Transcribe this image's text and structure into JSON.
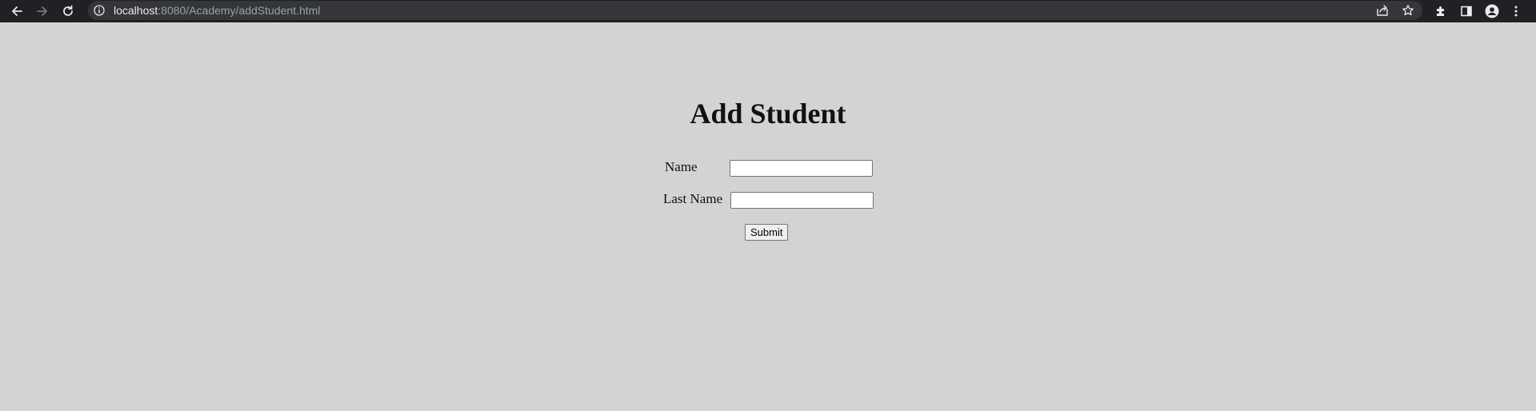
{
  "browser": {
    "url_host": "localhost",
    "url_rest": ":8080/Academy/addStudent.html",
    "icons": {
      "back": "back-arrow-icon",
      "forward": "forward-arrow-icon",
      "reload": "reload-icon",
      "info": "info-icon",
      "share": "share-icon",
      "bookmark": "star-icon",
      "extensions": "puzzle-icon",
      "side_panel": "side-panel-icon",
      "profile": "profile-icon",
      "menu": "kebab-menu-icon"
    }
  },
  "page": {
    "title": "Add Student",
    "fields": {
      "name_label": "Name",
      "name_value": "",
      "last_name_label": "Last Name",
      "last_name_value": ""
    },
    "submit_label": "Submit"
  },
  "colors": {
    "page_background": "#d3d3d3",
    "toolbar_background": "#202124",
    "omnibox_background": "#35363a"
  }
}
